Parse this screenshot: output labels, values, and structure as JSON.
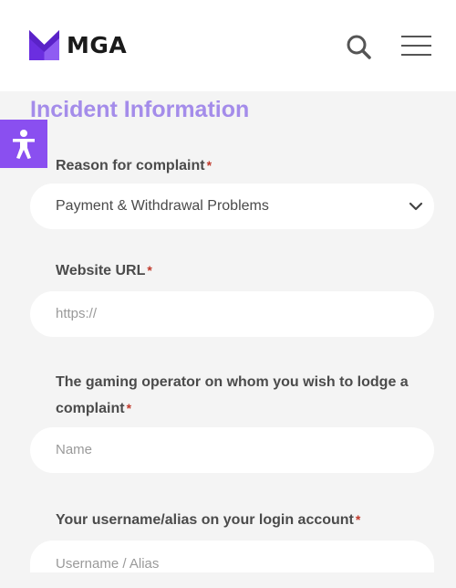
{
  "header": {
    "logo_text": "MGA",
    "brand_color": "#6b2ee0",
    "search_icon": "search-icon",
    "menu_icon": "hamburger-menu-icon"
  },
  "accessibility": {
    "icon": "accessibility-icon",
    "color": "#8a4ff0"
  },
  "form": {
    "section_title": "Incident Information",
    "required_marker": "*",
    "reason": {
      "label": "Reason for complaint",
      "value": "Payment & Withdrawal Problems"
    },
    "website": {
      "label": "Website URL",
      "placeholder": "https://"
    },
    "operator": {
      "label_line1": "The gaming operator on whom you wish to lodge a",
      "label_line2": "complaint",
      "placeholder": "Name"
    },
    "username": {
      "label": "Your username/alias on your login account",
      "placeholder": "Username / Alias"
    }
  }
}
